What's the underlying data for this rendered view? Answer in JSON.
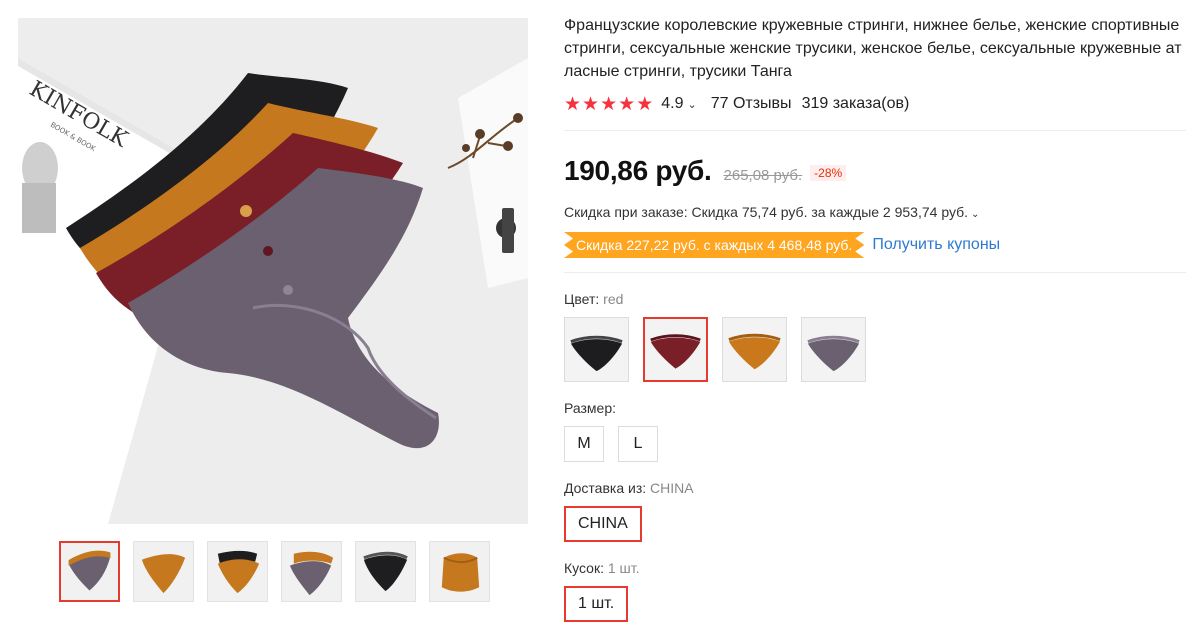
{
  "product": {
    "title": "Французские королевские кружевные стринги, нижнее белье, женские спортивные стринги, сексуальные женские трусики, женское белье, сексуальные кружевные атласные стринги, трусики Танга",
    "rating": "4.9",
    "reviews": "77 Отзывы",
    "orders": "319 заказа(ов)",
    "stars_count": 5
  },
  "gallery": {
    "main_image": "lace-thong-stack-photo",
    "thumbnails": [
      "thong-set-grey",
      "thong-orange",
      "thong-orange-black",
      "thong-grey-orange",
      "thong-black",
      "thong-orange-folded"
    ],
    "active_index": 0,
    "magazine_text": "KINFOLK",
    "magazine_sub": "BOOK & BOOK"
  },
  "price": {
    "current": "190,86 руб.",
    "original": "265,08 руб.",
    "discount_badge": "-28%",
    "order_discount": "Скидка при заказе: Скидка 75,74 руб. за каждые 2 953,74 руб.",
    "coupon": "Скидка 227,22 руб. с каждых 4 468,48 руб.",
    "get_coupons": "Получить купоны"
  },
  "options": {
    "color_label": "Цвет:",
    "color_selected": "red",
    "colors": [
      "black",
      "red",
      "orange",
      "grey"
    ],
    "color_hex": {
      "black": "#1d1d1f",
      "red": "#7a1f27",
      "orange": "#c9781c",
      "grey": "#6a6070"
    },
    "size_label": "Размер:",
    "sizes": [
      "M",
      "L"
    ],
    "ship_label": "Доставка из:",
    "ship_selected": "CHINA",
    "ship_option": "CHINA",
    "qty_label": "Кусок:",
    "qty_selected": "1 шт.",
    "qty_option": "1 шт."
  },
  "colors": {
    "accent": "#e63a2e",
    "star": "#f5333f",
    "coupon": "#ffa51f",
    "link": "#2e7ad1"
  }
}
